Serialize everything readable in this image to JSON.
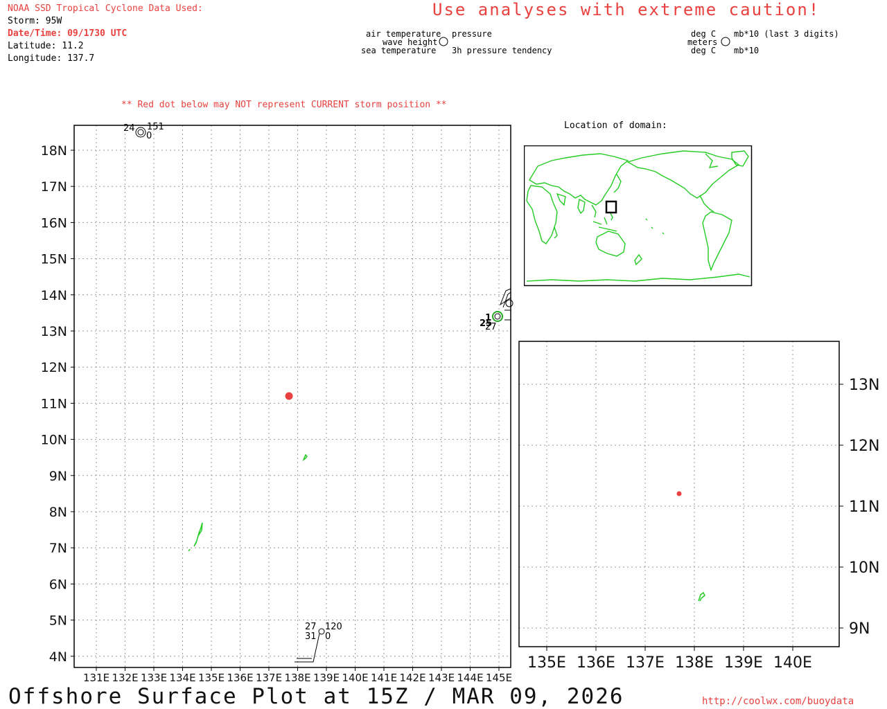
{
  "header": {
    "source": "NOAA SSD Tropical Cyclone Data Used:",
    "storm": "Storm: 95W",
    "datetime": "Date/Time: 09/1730 UTC",
    "latitude": "Latitude: 11.2",
    "longitude": "Longitude: 137.7"
  },
  "caution": "Use analyses with extreme caution!",
  "station_legend": {
    "air_temperature": "air temperature",
    "wave_height": "wave height",
    "sea_temperature": "sea temperature",
    "pressure": "pressure",
    "pressure_tendency": "3h pressure tendency"
  },
  "units_legend": {
    "air_temp_unit": "deg C",
    "wave_unit": "meters",
    "sea_temp_unit": "deg C",
    "pressure_unit": "mb*10 (last 3 digits)",
    "tendency_unit": "mb*10"
  },
  "warning": "** Red dot below may NOT represent CURRENT storm position **",
  "inset_title": "Location of domain:",
  "footer": {
    "title": "Offshore Surface Plot at 15Z / MAR 09, 2026",
    "url": "http://coolwx.com/buoydata"
  },
  "colors": {
    "storm_dot": "#e8413f",
    "land": "#22cc22",
    "grid": "#9a9a9a",
    "caution": "#e8413f"
  },
  "main_map": {
    "lat_labels": [
      "18N",
      "17N",
      "16N",
      "15N",
      "14N",
      "13N",
      "12N",
      "11N",
      "10N",
      "9N",
      "8N",
      "7N",
      "6N",
      "5N",
      "4N"
    ],
    "lon_labels": [
      "131E",
      "132E",
      "133E",
      "134E",
      "135E",
      "136E",
      "137E",
      "138E",
      "139E",
      "140E",
      "141E",
      "142E",
      "143E",
      "144E",
      "145E"
    ],
    "storm_lat": 11.2,
    "storm_lon": 137.7,
    "stations": [
      {
        "label_tl": "24",
        "label_tr": "151",
        "label_br": "0"
      },
      {
        "label_tl": "27",
        "label_tr": "120",
        "label_bl": "31",
        "label_br": "0"
      },
      {
        "label_tl": "1",
        "label_bl": "25",
        "label_b": "27"
      }
    ]
  },
  "zoom_map": {
    "lat_labels": [
      "13N",
      "12N",
      "11N",
      "10N",
      "9N"
    ],
    "lon_labels": [
      "135E",
      "136E",
      "137E",
      "138E",
      "139E",
      "140E"
    ]
  }
}
